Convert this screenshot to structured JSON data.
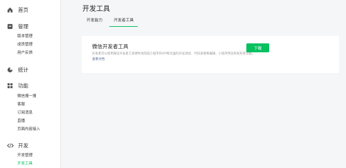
{
  "sidebar": {
    "sections": [
      {
        "icon": "home-icon",
        "label": "首页",
        "items": []
      },
      {
        "icon": "management-icon",
        "label": "管理",
        "items": [
          "版本管理",
          "成员管理",
          "用户反馈"
        ]
      },
      {
        "icon": "statistics-icon",
        "label": "统计",
        "items": []
      },
      {
        "icon": "features-icon",
        "label": "功能",
        "items": [
          "微信搜一搜",
          "客服",
          "订阅消息",
          "直播",
          "页面内容接入"
        ]
      },
      {
        "icon": "code-icon",
        "label": "开发",
        "items": [
          "开发管理",
          "开发工具"
        ]
      }
    ],
    "active_item": "开发工具"
  },
  "page": {
    "title": "开发工具"
  },
  "tabs": [
    {
      "label": "开发能力",
      "active": false
    },
    {
      "label": "开发者工具",
      "active": true
    }
  ],
  "card": {
    "title": "微信开发者工具",
    "description": "开发者可以使用微信开发者工具便利地完成小程序的API和页面的开发调试、代码查看和编辑、小程序预览和发布等功能。",
    "link": "查看文档",
    "button": "下载"
  },
  "colors": {
    "accent": "#07c160",
    "link": "#576b95",
    "background": "#f5f6f7"
  }
}
